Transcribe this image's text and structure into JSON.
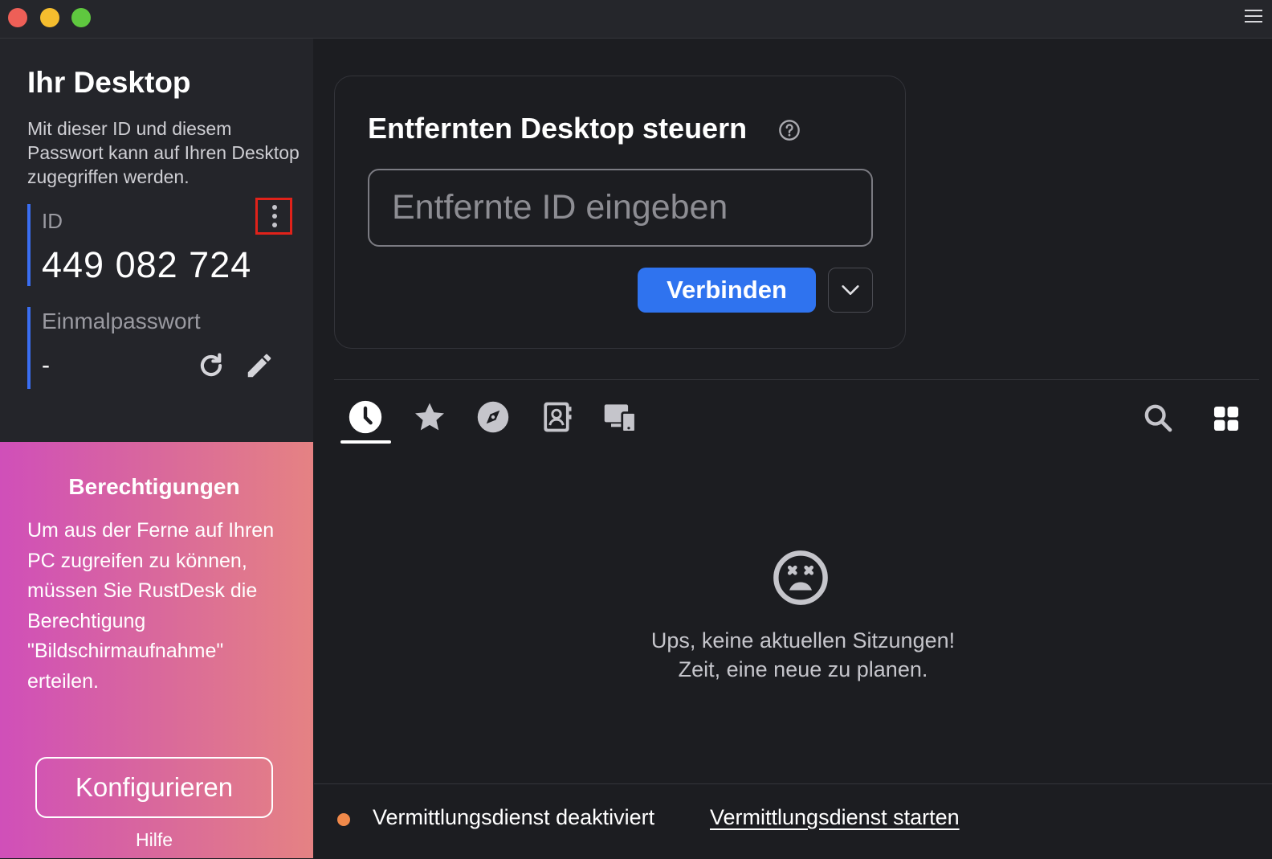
{
  "window": {
    "controls": [
      "close",
      "minimize",
      "maximize"
    ],
    "menu_icon": "hamburger-menu-icon"
  },
  "sidebar": {
    "title": "Ihr Desktop",
    "description": "Mit dieser ID und diesem Passwort kann auf Ihren Desktop zugegriffen werden.",
    "id_label": "ID",
    "id_value": "449 082 724",
    "password_label": "Einmalpasswort",
    "password_value": "-"
  },
  "permissions": {
    "title": "Berechtigungen",
    "text": "Um aus der Ferne auf Ihren PC zugreifen zu können, müssen Sie RustDesk die Berechtigung \"Bildschirmaufnahme\" erteilen.",
    "button_label": "Konfigurieren",
    "help_label": "Hilfe"
  },
  "connect": {
    "title": "Entfernten Desktop steuern",
    "input_placeholder": "Entfernte ID eingeben",
    "input_value": "",
    "button_label": "Verbinden"
  },
  "tabs": [
    {
      "icon": "clock-icon",
      "active": true
    },
    {
      "icon": "star-icon",
      "active": false
    },
    {
      "icon": "compass-icon",
      "active": false
    },
    {
      "icon": "address-book-icon",
      "active": false
    },
    {
      "icon": "devices-icon",
      "active": false
    }
  ],
  "empty_state": {
    "line1": "Ups, keine aktuellen Sitzungen!",
    "line2": "Zeit, eine neue zu planen."
  },
  "status": {
    "text": "Vermittlungsdienst deaktiviert",
    "link": "Vermittlungsdienst starten",
    "dot_color": "#f0894a"
  },
  "colors": {
    "accent": "#2f73ef",
    "highlight_border": "#e0221a"
  }
}
